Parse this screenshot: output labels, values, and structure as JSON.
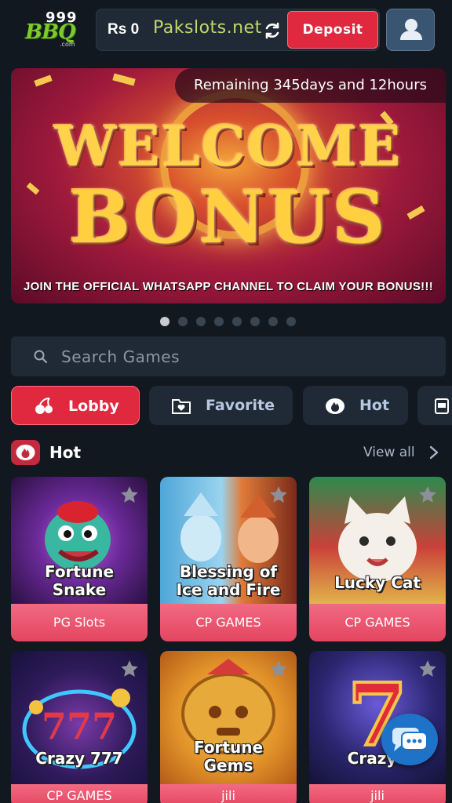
{
  "header": {
    "logo_top": "999",
    "logo_main": "BBQ",
    "logo_sub": ".com",
    "balance": "Rs 0",
    "site_name": "Pakslots.net",
    "deposit_label": "Deposit"
  },
  "banner": {
    "remaining": "Remaining 345days and 12hours",
    "headline1": "WELCOME",
    "headline2": "BONUS",
    "caption": "JOIN THE OFFICIAL WHATSAPP CHANNEL TO CLAIM YOUR BONUS!!!",
    "slide_count": 8,
    "active_slide": 1
  },
  "search": {
    "placeholder": "Search Games"
  },
  "tabs": [
    {
      "label": "Lobby",
      "icon": "cherry-icon",
      "active": true
    },
    {
      "label": "Favorite",
      "icon": "heart-folder-icon",
      "active": false
    },
    {
      "label": "Hot",
      "icon": "fire-icon",
      "active": false
    },
    {
      "label": "",
      "icon": "slot-machine-icon",
      "active": false
    }
  ],
  "section": {
    "title": "Hot",
    "view_all": "View all"
  },
  "games_row1": [
    {
      "name_line1": "Fortune",
      "name_line2": "Snake",
      "provider": "PG Slots"
    },
    {
      "name_line1": "Blessing of",
      "name_line2": "Ice and Fire",
      "provider": "CP GAMES"
    },
    {
      "name_line1": "Lucky Cat",
      "name_line2": "",
      "provider": "CP GAMES"
    }
  ],
  "games_row2": [
    {
      "name_line1": "Crazy 777",
      "name_line2": "",
      "provider": "CP GAMES"
    },
    {
      "name_line1": "Fortune",
      "name_line2": "Gems",
      "provider": "jili"
    },
    {
      "name_line1": "Crazy7",
      "name_line2": "",
      "provider": "jili"
    }
  ],
  "colors": {
    "background": "#111820",
    "accent": "#e0283f",
    "panel": "#1f2a36"
  }
}
